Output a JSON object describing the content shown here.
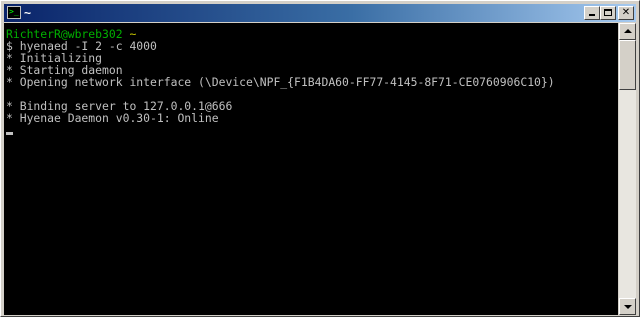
{
  "window": {
    "title": "~",
    "icon": "terminal-icon",
    "icon_glyph": ">_",
    "buttons": {
      "minimize": "minimize-icon",
      "maximize": "maximize-icon",
      "close_glyph": "✕"
    }
  },
  "console": {
    "prompt_user": "RichterR@wbreb302",
    "prompt_path": "~",
    "lines": [
      "$ hyenaed -I 2 -c 4000",
      "* Initializing",
      "* Starting daemon",
      "* Opening network interface (\\Device\\NPF_{F1B4DA60-FF77-4145-8F71-CE0760906C10})",
      "",
      "* Binding server to 127.0.0.1@666",
      "* Hyenae Daemon v0.30-1: Online"
    ]
  },
  "colors": {
    "console_bg": "#000000",
    "console_text": "#c0c0c0",
    "prompt_user": "#00b000",
    "prompt_path": "#c8c800",
    "titlebar_start": "#0a246a",
    "titlebar_end": "#a6caf0"
  }
}
